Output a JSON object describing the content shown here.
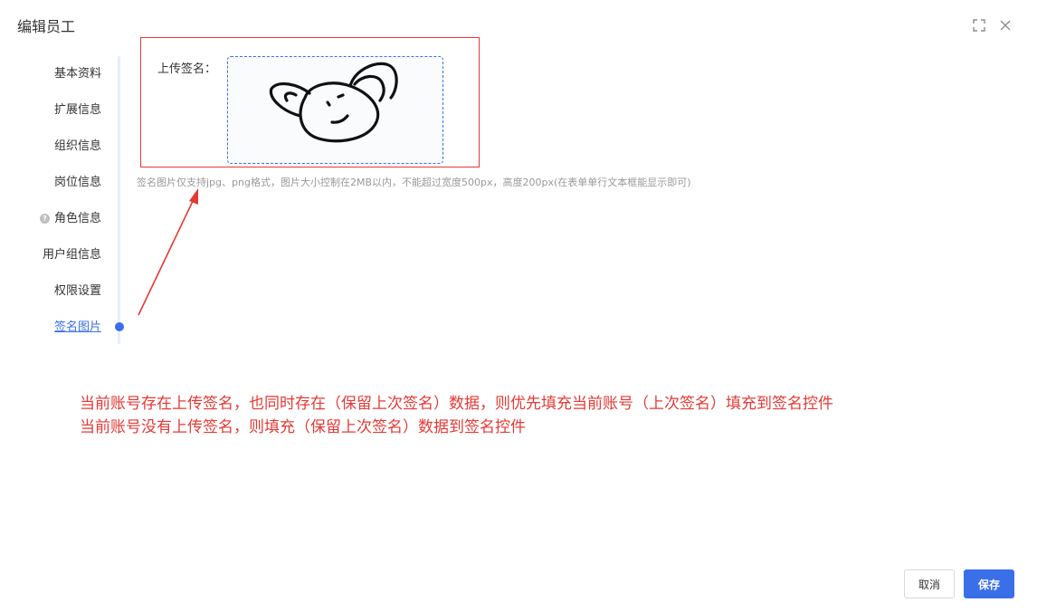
{
  "dialog": {
    "title": "编辑员工"
  },
  "nav": {
    "items": [
      {
        "label": "基本资料"
      },
      {
        "label": "扩展信息"
      },
      {
        "label": "组织信息"
      },
      {
        "label": "岗位信息"
      },
      {
        "label": "角色信息"
      },
      {
        "label": "用户组信息"
      },
      {
        "label": "权限设置"
      },
      {
        "label": "签名图片"
      }
    ],
    "active_index": 7
  },
  "upload": {
    "label": "上传签名：",
    "hint": "签名图片仅支持jpg、png格式，图片大小控制在2MB以内，不能超过宽度500px，高度200px(在表单单行文本框能显示即可)"
  },
  "annotation": {
    "line1": "当前账号存在上传签名，也同时存在（保留上次签名）数据，则优先填充当前账号（上次签名）填充到签名控件",
    "line2": "当前账号没有上传签名，则填充（保留上次签名）数据到签名控件"
  },
  "footer": {
    "cancel_label": "取消",
    "save_label": "保存"
  },
  "colors": {
    "primary": "#3a6fe8",
    "annotation_red": "#e53935",
    "hint_gray": "#999999"
  },
  "icons": [
    "fullscreen-icon",
    "close-icon",
    "help-icon",
    "signature-image"
  ]
}
